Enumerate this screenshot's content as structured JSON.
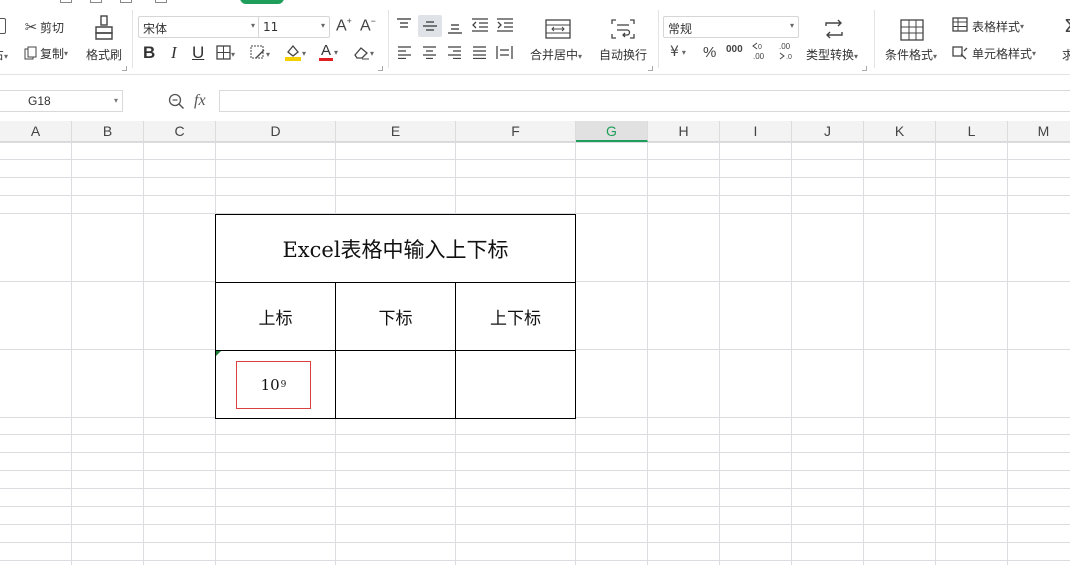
{
  "ribbon": {
    "clipboard": {
      "cut": "剪切",
      "copy": "复制",
      "format_painter": "格式刷",
      "paste_fragment": "占"
    },
    "font": {
      "name": "宋体",
      "size": "11",
      "bold": "B",
      "italic": "I",
      "underline": "U",
      "font_color_letter": "A",
      "grow": "A",
      "shrink": "A"
    },
    "alignment": {
      "merge_center": "合并居中",
      "wrap_text": "自动换行"
    },
    "number": {
      "format": "常规",
      "currency": "¥",
      "percent": "%",
      "thousands": "000",
      "type_convert": "类型转换"
    },
    "styles": {
      "conditional_format": "条件格式",
      "table_style": "表格样式",
      "cell_style": "单元格样式",
      "sum_fragment": "求"
    }
  },
  "formula_bar": {
    "name_box": "G18",
    "fx": "fx",
    "content": ""
  },
  "columns": [
    "A",
    "B",
    "C",
    "D",
    "E",
    "F",
    "G",
    "H",
    "I",
    "J",
    "K",
    "L",
    "M"
  ],
  "selected_column": "G",
  "table": {
    "title": "Excel表格中输入上下标",
    "headers": [
      "上标",
      "下标",
      "上下标"
    ],
    "superscript_base": "10",
    "superscript_exp": "9"
  },
  "colors": {
    "accent_green": "#1e9e5a",
    "font_color_red": "#e02020",
    "highlight_yellow": "#f5d000",
    "border_red": "#d94040"
  }
}
